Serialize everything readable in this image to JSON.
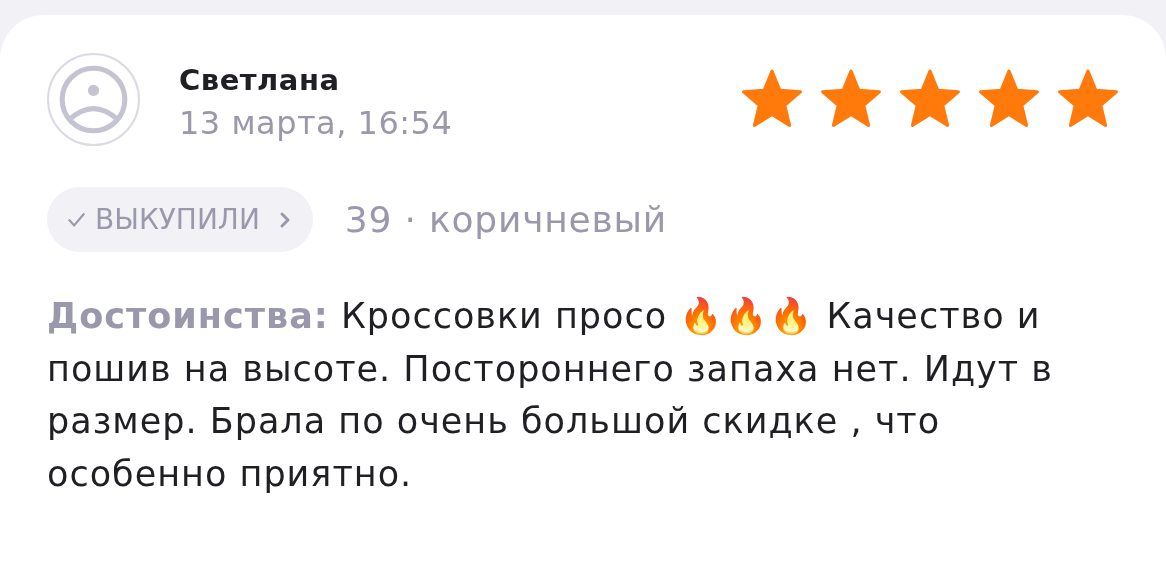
{
  "review": {
    "author": "Светлана",
    "date": "13 марта, 16:54",
    "stars": 5,
    "badge": {
      "checked": true,
      "label": "ВЫКУПИЛИ"
    },
    "variant": "39 · коричневый",
    "text": "**Достоинства:** Кроссовки просо 🔥🔥🔥 Качество и пошив на высоте. Постороннего запаха нет. Идут в размер. Брала по очень большой скидке , что особенно приятно."
  }
}
